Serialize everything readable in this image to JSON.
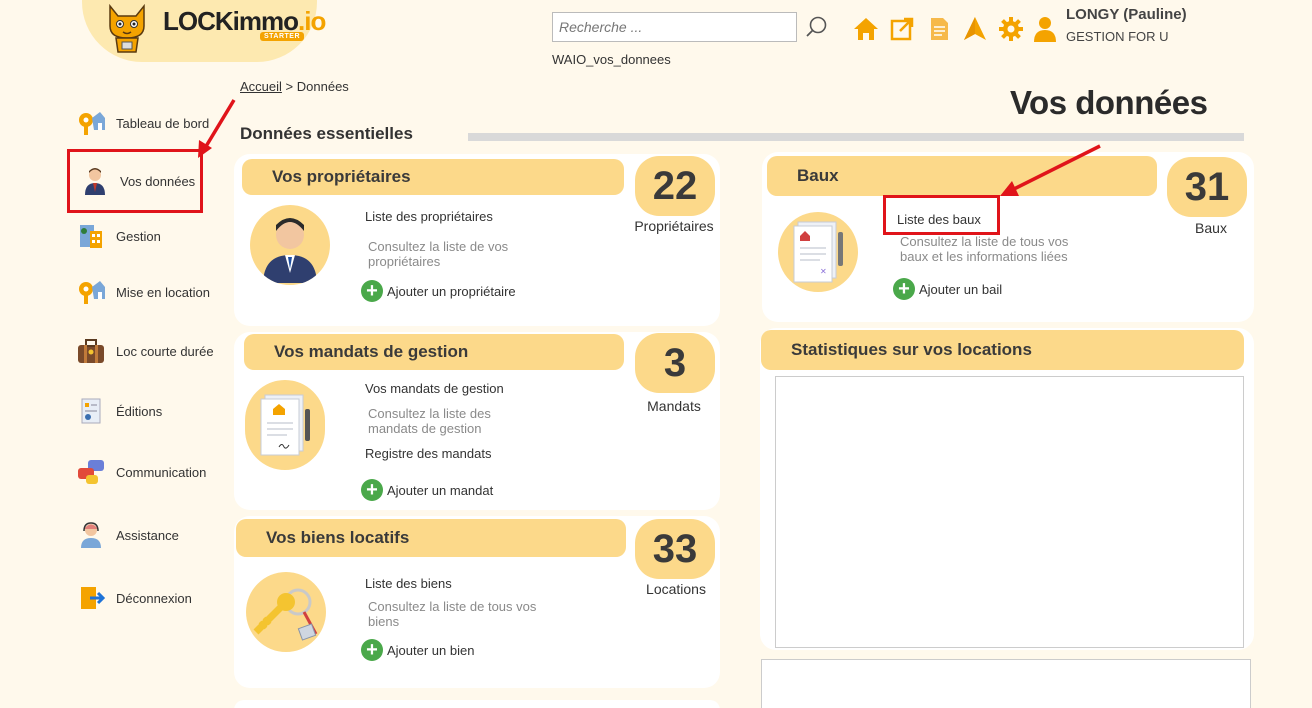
{
  "brand": {
    "name_main": "LOCKimmo",
    "name_suffix": ".io",
    "edition": "STARTER"
  },
  "header": {
    "search_placeholder": "Recherche ...",
    "database": "WAIO_vos_donnees",
    "user_name": "LONGY (Pauline)",
    "user_org": "GESTION FOR U",
    "icons": [
      "home-icon",
      "external-link-icon",
      "document-icon",
      "navigation-arrow-icon",
      "gear-icon",
      "user-icon"
    ]
  },
  "sidebar": {
    "items": [
      {
        "label": "Tableau de bord",
        "icon": "dashboard-key-icon"
      },
      {
        "label": "Vos données",
        "icon": "person-icon"
      },
      {
        "label": "Gestion",
        "icon": "management-icon"
      },
      {
        "label": "Mise en location",
        "icon": "rental-key-icon"
      },
      {
        "label": "Loc courte durée",
        "icon": "suitcase-icon"
      },
      {
        "label": "Éditions",
        "icon": "report-icon"
      },
      {
        "label": "Communication",
        "icon": "chat-icon"
      },
      {
        "label": "Assistance",
        "icon": "support-agent-icon"
      },
      {
        "label": "Déconnexion",
        "icon": "logout-icon"
      }
    ]
  },
  "breadcrumb": {
    "home": "Accueil",
    "separator": ">",
    "current": "Données"
  },
  "page_title": "Vos données",
  "section_title": "Données essentielles",
  "cards": {
    "owners": {
      "title": "Vos propriétaires",
      "count": "22",
      "count_label": "Propriétaires",
      "link": "Liste des propriétaires",
      "desc": "Consultez la liste de vos propriétaires",
      "add": "Ajouter un propriétaire"
    },
    "mandates": {
      "title": "Vos mandats de gestion",
      "count": "3",
      "count_label": "Mandats",
      "link": "Vos mandats de gestion",
      "desc": "Consultez la liste des mandats de gestion",
      "link2": "Registre des mandats",
      "add": "Ajouter un mandat"
    },
    "properties": {
      "title": "Vos biens locatifs",
      "count": "33",
      "count_label": "Locations",
      "link": "Liste des biens",
      "desc": "Consultez la liste de tous vos biens",
      "add": "Ajouter un bien"
    },
    "leases": {
      "title": "Baux",
      "count": "31",
      "count_label": "Baux",
      "link": "Liste des baux",
      "desc": "Consultez la liste de tous vos baux et les informations liées",
      "add": "Ajouter un bail"
    },
    "stats": {
      "title": "Statistiques sur vos locations"
    }
  },
  "colors": {
    "accent": "#fcd98a",
    "brand_orange": "#f4a300",
    "highlight_red": "#e0141a",
    "add_green": "#4aa84a"
  }
}
